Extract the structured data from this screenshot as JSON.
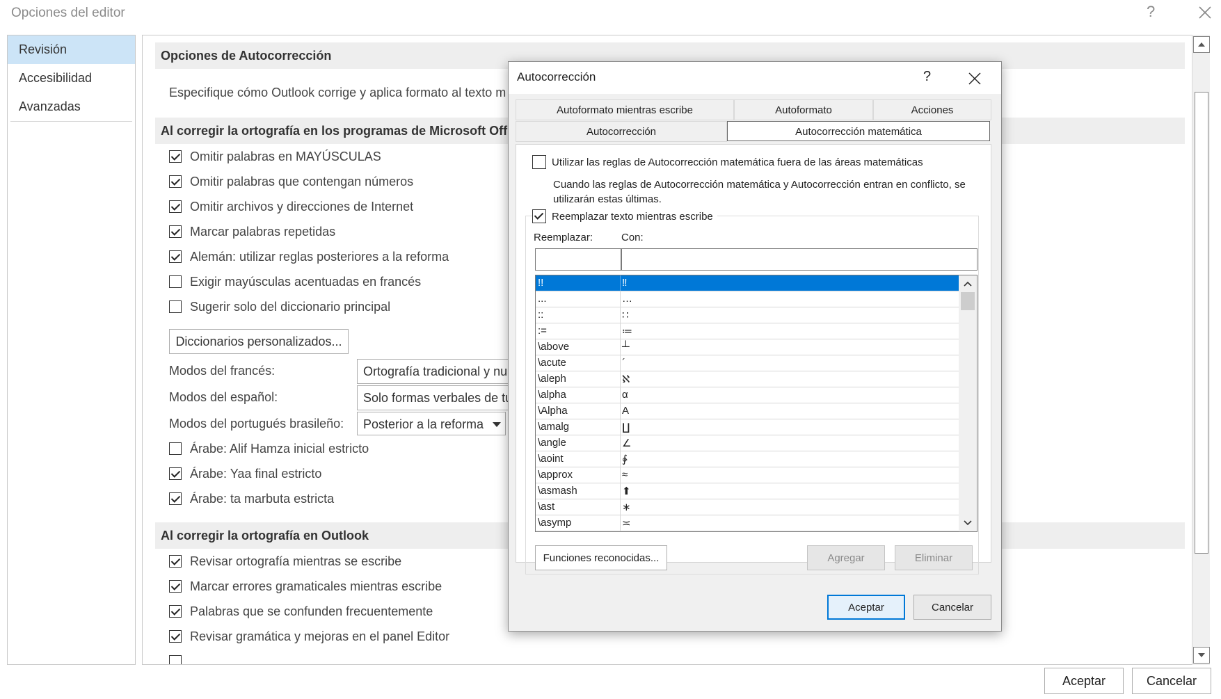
{
  "window": {
    "title": "Opciones del editor",
    "help": "?"
  },
  "nav": {
    "items": [
      {
        "label": "Revisión"
      },
      {
        "label": "Accesibilidad"
      },
      {
        "label": "Avanzadas"
      }
    ]
  },
  "content": {
    "section1_title": "Opciones de Autocorrección",
    "section1_desc": "Especifique cómo Outlook corrige y aplica formato al texto m",
    "section2_title": "Al corregir la ortografía en los programas de Microsoft Offi",
    "options": [
      {
        "label": "Omitir palabras en MAYÚSCULAS",
        "checked": true
      },
      {
        "label": "Omitir palabras que contengan números",
        "checked": true
      },
      {
        "label": "Omitir archivos y direcciones de Internet",
        "checked": true
      },
      {
        "label": "Marcar palabras repetidas",
        "checked": true
      },
      {
        "label": "Alemán: utilizar reglas posteriores a la reforma",
        "checked": true
      },
      {
        "label": "Exigir mayúsculas acentuadas en francés",
        "checked": false
      },
      {
        "label": "Sugerir solo del diccionario principal",
        "checked": false
      }
    ],
    "dictionaries_button": "Diccionarios personalizados...",
    "modes": [
      {
        "label": "Modos del francés:",
        "value": "Ortografía tradicional y nu"
      },
      {
        "label": "Modos del español:",
        "value": "Solo formas verbales de tu"
      },
      {
        "label": "Modos del portugués brasileño:",
        "value": "Posterior a la reforma"
      }
    ],
    "arabic_options": [
      {
        "label": "Árabe: Alif Hamza inicial estricto",
        "checked": false
      },
      {
        "label": "Árabe: Yaa final estricto",
        "checked": true
      },
      {
        "label": "Árabe: ta marbuta estricta",
        "checked": true
      }
    ],
    "section3_title": "Al corregir la ortografía en Outlook",
    "outlook_options": [
      {
        "label": "Revisar ortografía mientras se escribe",
        "checked": true
      },
      {
        "label": "Marcar errores gramaticales mientras escribe",
        "checked": true
      },
      {
        "label": "Palabras que se confunden frecuentemente",
        "checked": true
      },
      {
        "label": "Revisar gramática y mejoras en el panel Editor",
        "checked": true
      }
    ]
  },
  "footer": {
    "ok": "Aceptar",
    "cancel": "Cancelar"
  },
  "dialog": {
    "title": "Autocorrección",
    "help": "?",
    "tabs_row1": [
      "Autoformato mientras escribe",
      "Autoformato",
      "Acciones"
    ],
    "tabs_row2": [
      "Autocorrección",
      "Autocorrección matemática"
    ],
    "active_tab": "Autocorrección matemática",
    "use_outside_label": "Utilizar las reglas de Autocorrección matemática fuera de las áreas matemáticas",
    "use_outside_checked": false,
    "conflict_note": "Cuando las reglas de Autocorrección matemática y Autocorrección entran en conflicto, se utilizarán estas últimas.",
    "replace_while_typing_label": "Reemplazar texto mientras escribe",
    "replace_while_typing_checked": true,
    "replace_label": "Reemplazar:",
    "with_label": "Con:",
    "replace_value": "",
    "with_value": "",
    "entries": [
      {
        "key": "!!",
        "value": "‼"
      },
      {
        "key": "...",
        "value": "…"
      },
      {
        "key": "::",
        "value": "∷"
      },
      {
        "key": ":=",
        "value": "≔"
      },
      {
        "key": "\\above",
        "value": "┴"
      },
      {
        "key": "\\acute",
        "value": "´"
      },
      {
        "key": "\\aleph",
        "value": "ℵ"
      },
      {
        "key": "\\alpha",
        "value": "α"
      },
      {
        "key": "\\Alpha",
        "value": "A"
      },
      {
        "key": "\\amalg",
        "value": "∐"
      },
      {
        "key": "\\angle",
        "value": "∠"
      },
      {
        "key": "\\aoint",
        "value": "∳"
      },
      {
        "key": "\\approx",
        "value": "≈"
      },
      {
        "key": "\\asmash",
        "value": "⬆"
      },
      {
        "key": "\\ast",
        "value": "∗"
      },
      {
        "key": "\\asymp",
        "value": "≍"
      }
    ],
    "selected_index": 0,
    "recognized_functions_button": "Funciones reconocidas...",
    "add_button": "Agregar",
    "delete_button": "Eliminar",
    "ok": "Aceptar",
    "cancel": "Cancelar"
  }
}
